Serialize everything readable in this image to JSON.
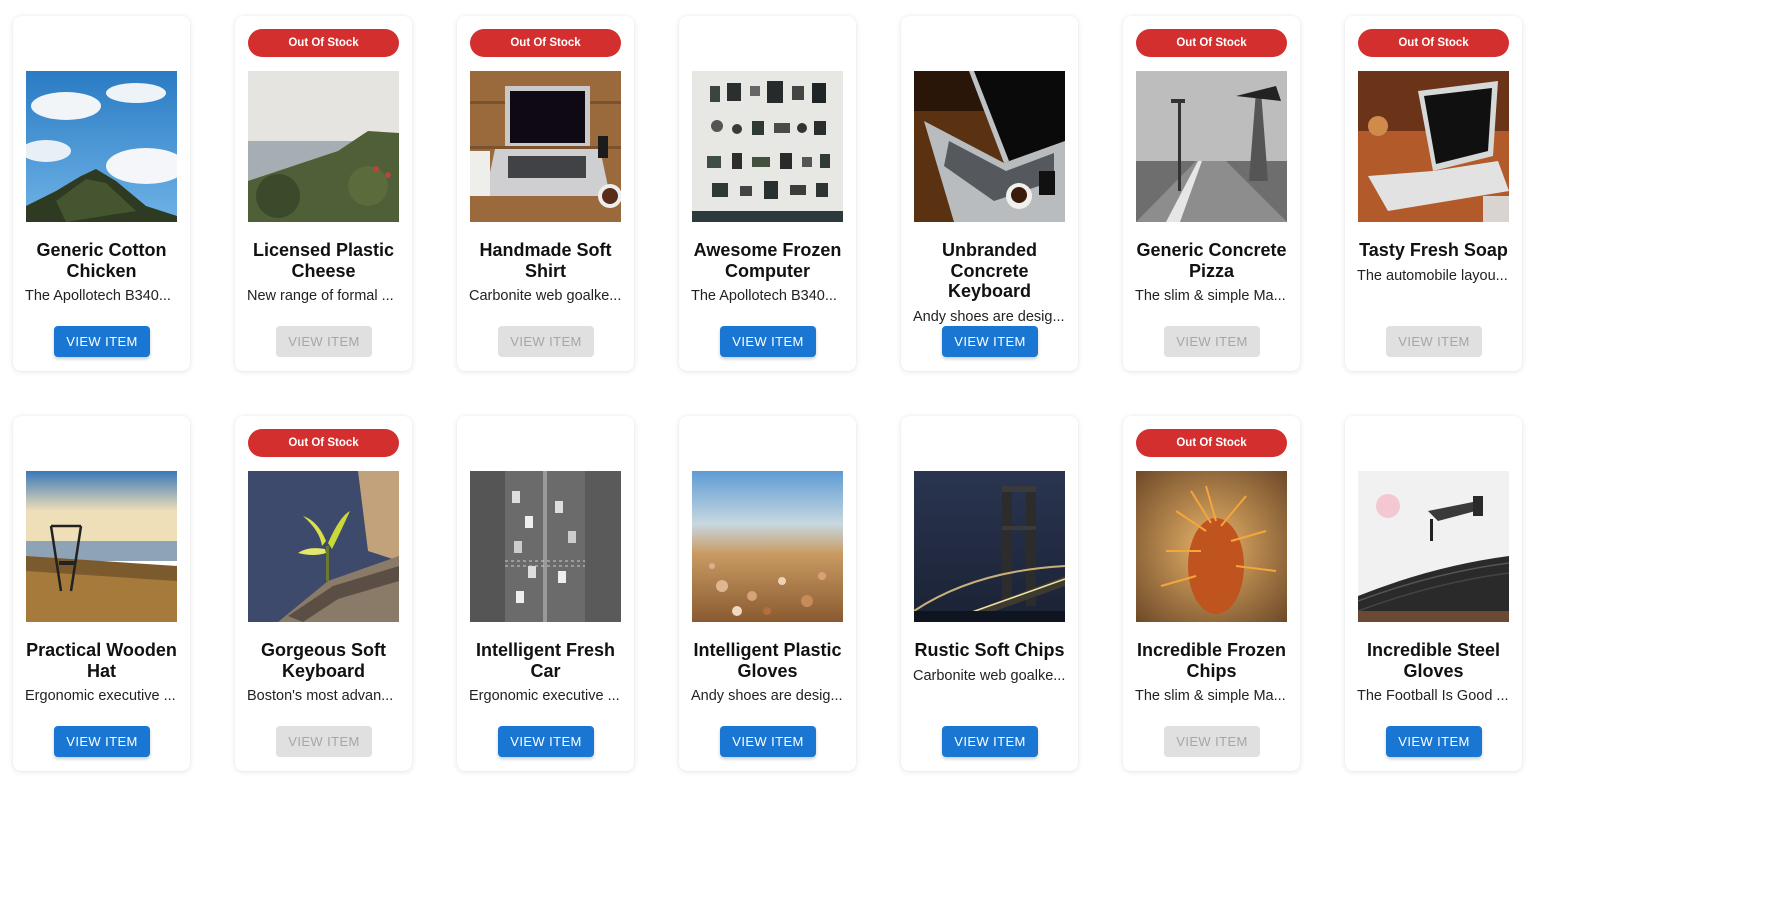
{
  "products": [
    {
      "name": "Generic Cotton Chicken",
      "description": "The Apollotech B340...",
      "out_of_stock": false,
      "image": "clouds-hilltop"
    },
    {
      "name": "Licensed Plastic Cheese",
      "description": "New range of formal ...",
      "out_of_stock": true,
      "image": "sea-cliff"
    },
    {
      "name": "Handmade Soft Shirt",
      "description": "Carbonite web goalke...",
      "out_of_stock": true,
      "image": "laptop-desk"
    },
    {
      "name": "Awesome Frozen Computer",
      "description": "The Apollotech B340...",
      "out_of_stock": false,
      "image": "gadgets-flatlay"
    },
    {
      "name": "Unbranded Concrete Keyboard",
      "description": "Andy shoes are desig...",
      "out_of_stock": false,
      "image": "laptop-table"
    },
    {
      "name": "Generic Concrete Pizza",
      "description": "The slim & simple Ma...",
      "out_of_stock": true,
      "image": "pier-bw"
    },
    {
      "name": "Tasty Fresh Soap",
      "description": "The automobile layou...",
      "out_of_stock": true,
      "image": "laptop-warm"
    },
    {
      "name": "Practical Wooden Hat",
      "description": "Ergonomic executive ...",
      "out_of_stock": false,
      "image": "swing-shore"
    },
    {
      "name": "Gorgeous Soft Keyboard",
      "description": "Boston's most advan...",
      "out_of_stock": true,
      "image": "plant-rock"
    },
    {
      "name": "Intelligent Fresh Car",
      "description": "Ergonomic executive ...",
      "out_of_stock": false,
      "image": "city-traffic-bw"
    },
    {
      "name": "Intelligent Plastic Gloves",
      "description": "Andy shoes are desig...",
      "out_of_stock": false,
      "image": "beach-pebbles"
    },
    {
      "name": "Rustic Soft Chips",
      "description": "Carbonite web goalke...",
      "out_of_stock": false,
      "image": "bridge-night"
    },
    {
      "name": "Incredible Frozen Chips",
      "description": "The slim & simple Ma...",
      "out_of_stock": true,
      "image": "cactus-macro"
    },
    {
      "name": "Incredible Steel Gloves",
      "description": "The Football Is Good ...",
      "out_of_stock": false,
      "image": "record-player"
    }
  ],
  "badge_label": "Out Of Stock",
  "button_label": "VIEW ITEM",
  "colors": {
    "badge": "#d32f2f",
    "button": "#1976d2",
    "button_disabled": "#e0e0e0"
  }
}
